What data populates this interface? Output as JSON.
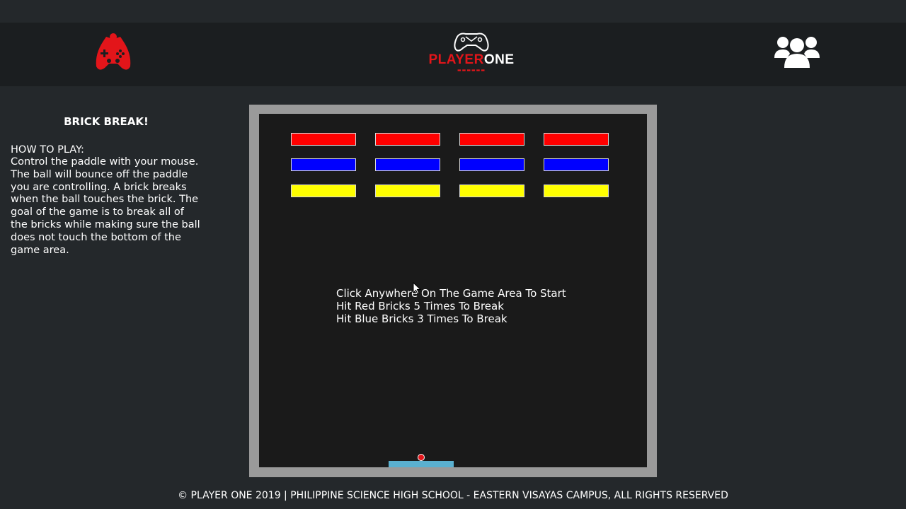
{
  "header": {
    "left_icon": "gamepad-controller-icon",
    "logo_word_red": "PLAYER",
    "logo_word_white": "ONE",
    "logo_icon": "game-controller-icon",
    "right_icon": "users-group-icon",
    "accent_color": "#e3151a"
  },
  "sidebar": {
    "title": "BRICK BREAK!",
    "howto_label": "HOW TO PLAY:",
    "howto_text": "Control the paddle with your mouse. The ball will bounce off the paddle you are controlling. A brick breaks when the ball touches the brick. The goal of the game is to break all of the bricks while making sure the ball does not touch the bottom of the game area."
  },
  "game": {
    "brick_rows": [
      {
        "color": "#ff0000",
        "count": 4
      },
      {
        "color": "#0000ff",
        "count": 4
      },
      {
        "color": "#ffff00",
        "count": 4
      }
    ],
    "instructions": [
      "Click Anywhere On The Game Area To Start",
      "Hit Red Bricks 5 Times To Break",
      "Hit Blue Bricks 3 Times To Break"
    ],
    "paddle_color": "#5ab0d0",
    "ball_color": "#e3151a"
  },
  "footer": {
    "text": "© PLAYER ONE 2019 | PHILIPPINE SCIENCE HIGH SCHOOL - EASTERN VISAYAS CAMPUS, ALL RIGHTS RESERVED"
  }
}
